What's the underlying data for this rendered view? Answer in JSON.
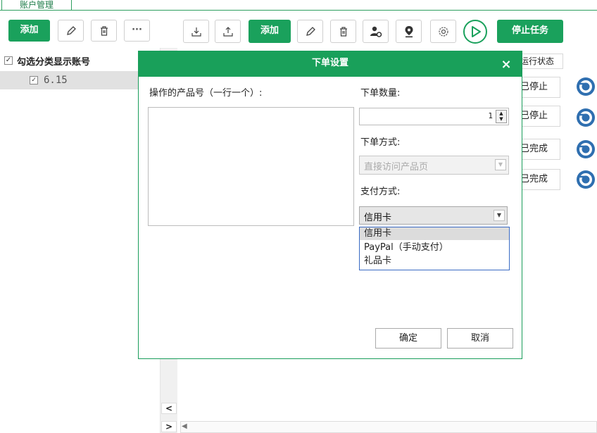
{
  "window": {
    "account_tab": "账户管理"
  },
  "left_toolbar": {
    "add_label": "添加",
    "more_label": "···"
  },
  "main_toolbar": {
    "add_label": "添加",
    "stop_label": "停止任务"
  },
  "left_panel": {
    "header_label": "勾选分类显示账号",
    "rows": [
      {
        "label": "6.15",
        "checked": true
      }
    ]
  },
  "table": {
    "status_header": "运行状态",
    "statuses": [
      "已停止",
      "已停止",
      "已完成",
      "已完成"
    ]
  },
  "dialog": {
    "title": "下单设置",
    "close_glyph": "×",
    "product_label": "操作的产品号（一行一个）:",
    "product_value": "",
    "quantity_label": "下单数量:",
    "quantity_value": "1",
    "order_method_label": "下单方式:",
    "order_method_value": "直接访问产品页",
    "payment_label": "支付方式:",
    "payment_value": "信用卡",
    "payment_options": [
      "信用卡",
      "PayPal（手动支付）",
      "礼品卡"
    ],
    "confirm_label": "确定",
    "cancel_label": "取消"
  },
  "colors": {
    "accent": "#19a05a",
    "dropdown_border": "#3a6bc4"
  },
  "icons": [
    "pencil-icon",
    "trash-icon",
    "import-icon",
    "export-icon",
    "location-icon",
    "settings-icon",
    "play-icon",
    "chrome-icon"
  ]
}
